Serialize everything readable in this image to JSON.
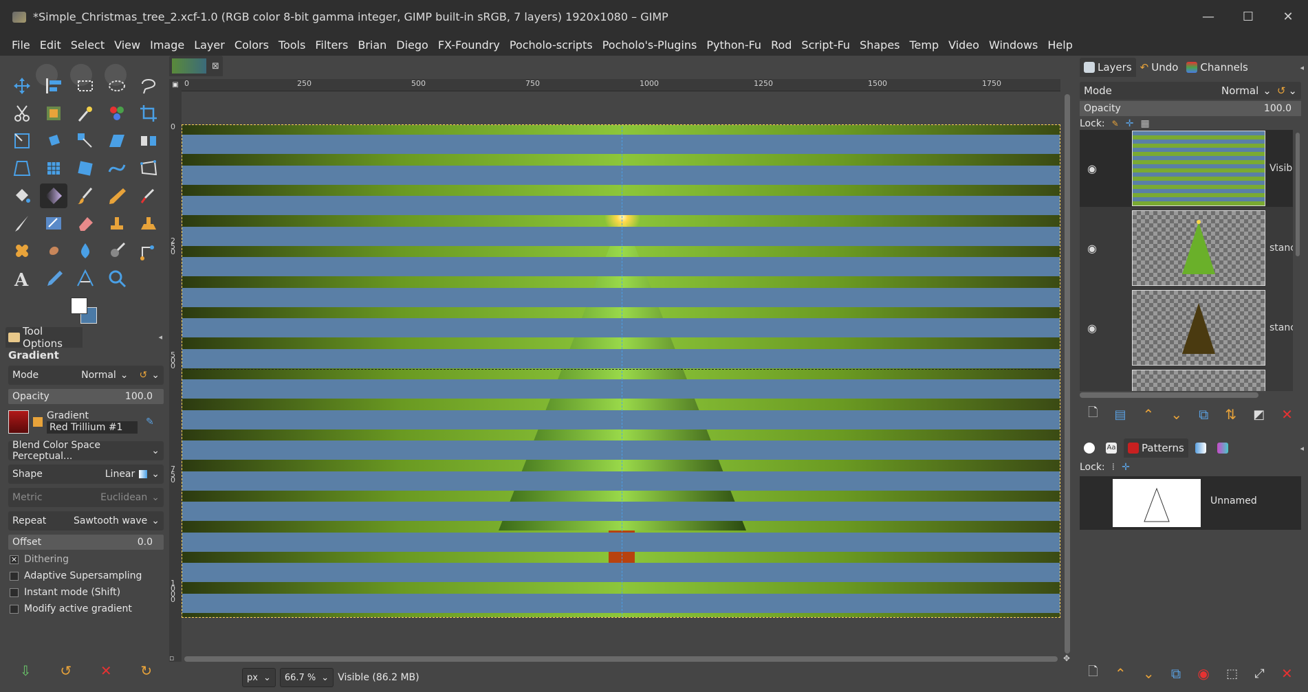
{
  "window": {
    "title": "*Simple_Christmas_tree_2.xcf-1.0 (RGB color 8-bit gamma integer, GIMP built-in sRGB, 7 layers) 1920x1080 – GIMP",
    "minimize": "—",
    "maximize": "☐",
    "close": "✕"
  },
  "menu": [
    "File",
    "Edit",
    "Select",
    "View",
    "Image",
    "Layer",
    "Colors",
    "Tools",
    "Filters",
    "Brian",
    "Diego",
    "FX-Foundry",
    "Pocholo-scripts",
    "Pocholo's-Plugins",
    "Python-Fu",
    "Rod",
    "Script-Fu",
    "Shapes",
    "Temp",
    "Video",
    "Windows",
    "Help"
  ],
  "tool_options": {
    "tab": "Tool Options",
    "heading": "Gradient",
    "mode_label": "Mode",
    "mode_value": "Normal",
    "opacity_label": "Opacity",
    "opacity_value": "100.0",
    "gradient_label": "Gradient",
    "gradient_name": "Red Trillium #1",
    "blend_space": "Blend Color Space Perceptual...",
    "shape_label": "Shape",
    "shape_value": "Linear",
    "metric_label": "Metric",
    "metric_value": "Euclidean",
    "repeat_label": "Repeat",
    "repeat_value": "Sawtooth wave",
    "offset_label": "Offset",
    "offset_value": "0.0",
    "dithering": "Dithering",
    "adaptive": "Adaptive Supersampling",
    "instant": "Instant mode  (Shift)",
    "modify": "Modify active gradient",
    "checked_mark": "✕"
  },
  "ruler": {
    "h_labels": [
      "0",
      "250",
      "500",
      "750",
      "1000",
      "1250",
      "1500",
      "1750"
    ],
    "v_labels": [
      "0",
      "250",
      "500",
      "750",
      "1000"
    ]
  },
  "status": {
    "unit": "px",
    "zoom": "66.7 %",
    "info": "Visible (86.2 MB)"
  },
  "dock": {
    "tabs": [
      "Layers",
      "Undo",
      "Channels"
    ],
    "mode_label": "Mode",
    "mode_value": "Normal",
    "opacity_label": "Opacity",
    "opacity_value": "100.0",
    "lock_label": "Lock:",
    "layers": [
      {
        "name": "Visibl"
      },
      {
        "name": "stanc"
      },
      {
        "name": "stanc"
      }
    ]
  },
  "patterns": {
    "tab": "Patterns",
    "lock_label": "Lock:",
    "item_name": "Unnamed"
  },
  "colors": {
    "accent": "#e8a33a",
    "stripe_blue": "#5a7fa6",
    "fg": "#ffffff",
    "bg": "#4b7aa6"
  }
}
